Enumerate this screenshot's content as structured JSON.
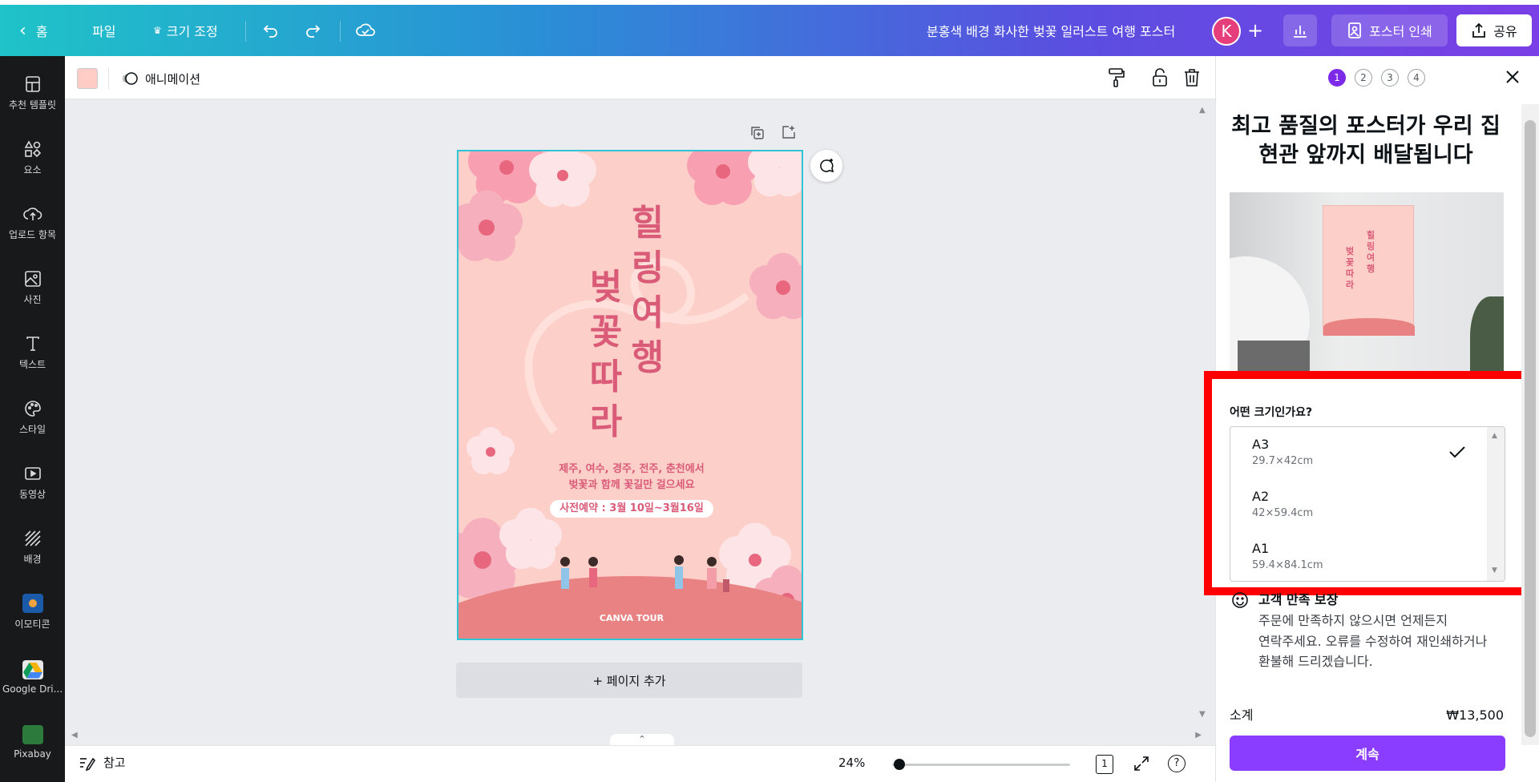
{
  "topbar": {
    "home": "홈",
    "file": "파일",
    "resize": "크기 조정",
    "doc_title": "분홍색 배경 화사한 벚꽃 일러스트 여행 포스터",
    "avatar_initial": "K",
    "print_label": "포스터 인쇄",
    "share_label": "공유"
  },
  "sidebar": {
    "items": [
      {
        "label": "추천 템플릿",
        "icon": "template-icon"
      },
      {
        "label": "요소",
        "icon": "elements-icon"
      },
      {
        "label": "업로드 항목",
        "icon": "upload-icon"
      },
      {
        "label": "사진",
        "icon": "photo-icon"
      },
      {
        "label": "텍스트",
        "icon": "text-icon"
      },
      {
        "label": "스타일",
        "icon": "palette-icon"
      },
      {
        "label": "동영상",
        "icon": "video-icon"
      },
      {
        "label": "배경",
        "icon": "background-icon"
      },
      {
        "label": "이모티콘",
        "icon": "emoji-app-icon"
      },
      {
        "label": "Google Dri...",
        "icon": "google-drive-icon"
      },
      {
        "label": "Pixabay",
        "icon": "pixabay-icon"
      }
    ]
  },
  "toolbar": {
    "animation": "애니메이션",
    "swatch_color": "#ffcdc6"
  },
  "poster": {
    "title_right": [
      "힐",
      "링",
      "여",
      "행"
    ],
    "title_left": [
      "벚",
      "꽃",
      "따",
      "라"
    ],
    "line1": "제주, 여수, 경주, 전주, 춘천에서",
    "line2": "벚꽃과 함께 꽃길만 걸으세요",
    "booking": "사전예약 : 3월 10일~3월16일",
    "footer": "CANVA TOUR"
  },
  "canvas": {
    "add_page": "+ 페이지 추가"
  },
  "bottombar": {
    "notes": "참고",
    "zoom": "24%",
    "page_num": "1",
    "zoom_fraction": 0.24
  },
  "panel": {
    "steps": [
      "1",
      "2",
      "3",
      "4"
    ],
    "active_step": "1",
    "title": "최고 품질의 포스터가 우리 집 현관 앞까지 배달됩니다",
    "size_question": "어떤 크기인가요?",
    "sizes": [
      {
        "name": "A3",
        "dims": "29.7×42cm",
        "selected": true
      },
      {
        "name": "A2",
        "dims": "42×59.4cm",
        "selected": false
      },
      {
        "name": "A1",
        "dims": "59.4×84.1cm",
        "selected": false
      }
    ],
    "guarantee_title": "고객 만족 보장",
    "guarantee_text1": "주문에 만족하지 않으시면 언제든지",
    "guarantee_text2": "연락주세요. 오류를 수정하여 재인쇄하거나",
    "guarantee_text3": "환불해 드리겠습니다.",
    "subtotal_label": "소계",
    "subtotal_value": "₩13,500",
    "continue": "계속"
  },
  "colors": {
    "accent": "#8b3dff",
    "highlight": "#ff0000",
    "poster_bg": "#fdcfc9",
    "poster_text": "#d95b78"
  }
}
